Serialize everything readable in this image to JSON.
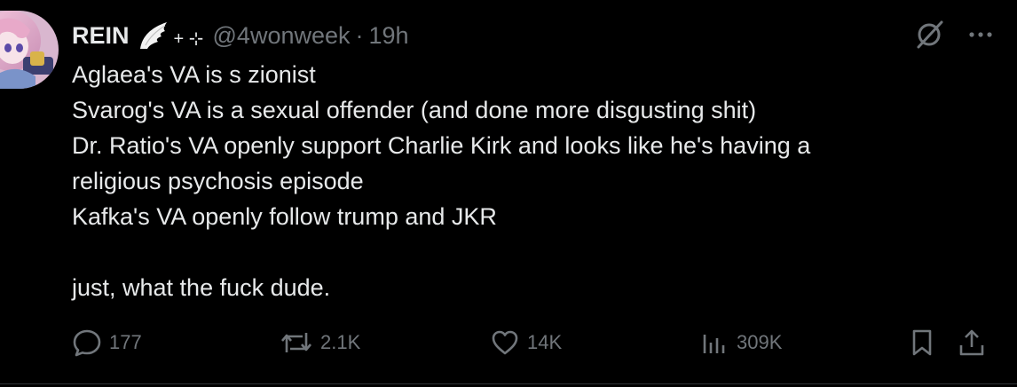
{
  "colors": {
    "background": "#000000",
    "text_primary": "#e7e9ea",
    "text_secondary": "#71767b",
    "divider": "#2f3336"
  },
  "post": {
    "author": {
      "display_name": "REIN",
      "name_decoration": "+ ⊹",
      "handle": "@4wonweek",
      "separator": "·",
      "time": "19h",
      "avatar_icon": "anime-avatar",
      "badge_icon": "angel-wing-icon"
    },
    "top_icons": [
      "grok-icon",
      "more-icon"
    ],
    "lines": [
      "Aglaea's VA is s zionist",
      "Svarog's VA is a sexual offender (and done more disgusting shit)",
      "Dr. Ratio's VA openly support Charlie Kirk and looks like he's having a",
      "religious psychosis episode",
      "Kafka's VA openly follow trump and JKR",
      "",
      "just, what the fuck dude."
    ],
    "actions": {
      "replies": {
        "icon": "reply-icon",
        "count": "177"
      },
      "reposts": {
        "icon": "repost-icon",
        "count": "2.1K"
      },
      "likes": {
        "icon": "like-icon",
        "count": "14K"
      },
      "views": {
        "icon": "views-icon",
        "count": "309K"
      },
      "bookmark": {
        "icon": "bookmark-icon"
      },
      "share": {
        "icon": "share-icon"
      }
    }
  }
}
